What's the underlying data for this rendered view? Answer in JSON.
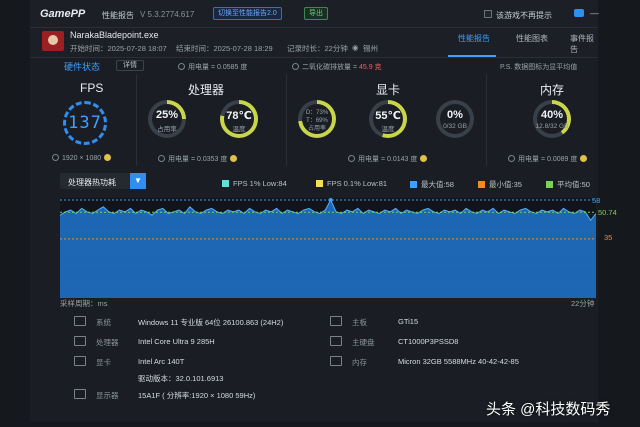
{
  "titlebar": {
    "logo": "GamePP",
    "app_name": "性能报告",
    "version": "V 5.3.2774.617",
    "switch_button": "切换至性能报告2.0",
    "export_button": "导出",
    "no_show_label": "该游戏不再提示"
  },
  "header": {
    "exe": "NarakaBladepoint.exe",
    "start_time": "开始时间：2025-07-28 18:07",
    "end_time": "结束时间：2025-07-28 18:29",
    "duration": "记录时长：22分钟",
    "location": "锡州",
    "tabs": [
      "性能报告",
      "性能图表",
      "事件报告"
    ]
  },
  "summary": {
    "hw_status": "硬件状态",
    "details": "详情",
    "power": "用电量 = 0.0585 度",
    "co2_prefix": "二氧化碳排放量 = ",
    "co2_value": "45.9 克",
    "note": "P.S. 数据图标为显平均值"
  },
  "fps": {
    "title": "FPS",
    "value": "137",
    "resolution": "1920 × 1080"
  },
  "cpu": {
    "title": "处理器",
    "usage": "25%",
    "usage_label": "占用率",
    "temp": "78℃",
    "temp_label": "温度",
    "power": "用电量 = 0.0353 度",
    "usage_frac": 0.25,
    "temp_frac": 0.78
  },
  "gpu": {
    "title": "显卡",
    "d_value": "D：73%",
    "t_value": "T：69%",
    "usage_label": "占用率",
    "temp": "55℃",
    "temp_label": "温度",
    "vram": "0%",
    "vram_sub": "0/32 GB",
    "power": "用电量 = 0.0143 度",
    "usage_frac": 0.73,
    "temp_frac": 0.55,
    "vram_frac": 0.0
  },
  "ram": {
    "title": "内存",
    "usage": "40%",
    "usage_sub": "12.8/32 GB",
    "power": "用电量 = 0.0089 度",
    "usage_frac": 0.4
  },
  "chart_controls": {
    "selector": "处理器热功耗"
  },
  "legend": [
    {
      "label": "FPS 1% Low:84",
      "color": "#5fe0d8"
    },
    {
      "label": "FPS 0.1% Low:81",
      "color": "#f0e34a"
    },
    {
      "label": "最大值:58",
      "color": "#3ea0ff"
    },
    {
      "label": "最小值:35",
      "color": "#f08c28"
    },
    {
      "label": "平均值:50",
      "color": "#7ed05a"
    }
  ],
  "chart_data": {
    "type": "area",
    "xlabel": "采样周期：ms",
    "x_end_label": "22分钟",
    "y_max_label": "58",
    "y_avg_label": "50.74",
    "y_min_label": "35",
    "ylim": [
      0,
      58
    ],
    "max": 58,
    "min": 35,
    "avg": 50.74,
    "values": [
      49,
      51,
      52,
      50,
      53,
      51,
      50,
      52,
      54,
      51,
      50,
      52,
      51,
      53,
      50,
      52,
      51,
      49,
      52,
      53,
      50,
      51,
      52,
      50,
      54,
      51,
      50,
      52,
      53,
      51,
      50,
      52,
      51,
      52,
      50,
      53,
      51,
      50,
      52,
      51,
      53,
      50,
      52,
      51,
      50,
      52,
      53,
      51,
      50,
      52,
      58,
      51,
      50,
      52,
      51,
      53,
      50,
      52,
      51,
      50,
      52,
      51,
      53,
      50,
      52,
      51,
      50,
      52,
      53,
      51,
      50,
      52,
      51,
      52,
      50,
      53,
      51,
      50,
      52,
      51,
      53,
      50,
      52,
      51,
      50,
      52,
      53,
      51,
      50,
      52,
      51,
      52,
      50,
      53,
      51,
      50,
      52,
      51,
      46,
      50
    ]
  },
  "specs": {
    "os_key": "系统",
    "os_val": "Windows 11 专业版 64位 26100.863 (24H2)",
    "cpu_key": "处理器",
    "cpu_val": "Intel Core Ultra 9 285H",
    "gpu_key": "显卡",
    "gpu_val": "Intel Arc 140T",
    "driver_val": "驱动版本：32.0.101.6913",
    "monitor_key": "显示器",
    "monitor_val": "15A1F ( 分辨率:1920 × 1080 59Hz)",
    "board_key": "主板",
    "board_val": "GTi15",
    "disk_key": "主硬盘",
    "disk_val": "CT1000P3PSSD8",
    "mem_key": "内存",
    "mem_val": "Micron 32GB 5588MHz 40-42-42-85"
  },
  "watermark": "头条 @科技数码秀"
}
